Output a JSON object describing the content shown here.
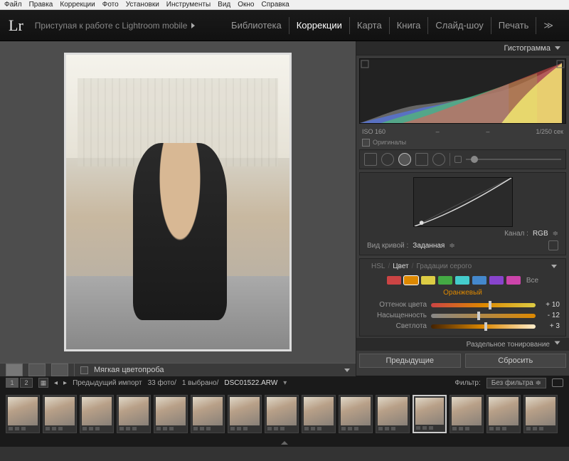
{
  "os_menu": [
    "Файл",
    "Правка",
    "Коррекции",
    "Фото",
    "Установки",
    "Инструменты",
    "Вид",
    "Окно",
    "Справка"
  ],
  "header": {
    "logo": "Lr",
    "mobile_link": "Приступая к работе с Lightroom mobile",
    "modules": [
      {
        "label": "Библиотека",
        "active": false
      },
      {
        "label": "Коррекции",
        "active": true
      },
      {
        "label": "Карта",
        "active": false
      },
      {
        "label": "Книга",
        "active": false
      },
      {
        "label": "Слайд-шоу",
        "active": false
      },
      {
        "label": "Печать",
        "active": false
      }
    ],
    "more_glyph": "≫"
  },
  "left_toolbar": {
    "softproof_label": "Мягкая цветопроба"
  },
  "panels": {
    "histogram": {
      "title": "Гистограмма",
      "meta": {
        "iso": "ISO 160",
        "aperture": "–",
        "focal": "–",
        "shutter": "1/250 сек"
      },
      "originals_label": "Оригиналы"
    },
    "tonecurve": {
      "channel_label": "Канал :",
      "channel_value": "RGB",
      "curve_type_label": "Вид кривой :",
      "curve_type_value": "Заданная"
    },
    "hsl": {
      "tabs": {
        "hsl": "HSL",
        "color": "Цвет",
        "bw": "Градации серого"
      },
      "active_tab": "Цвет",
      "all_label": "Все",
      "colors": [
        "#c44",
        "#d80",
        "#dc4",
        "#4a4",
        "#4cc",
        "#48c",
        "#84c",
        "#c4a"
      ],
      "selected_color_label": "Оранжевый",
      "sliders": [
        {
          "label": "Оттенок цвета",
          "value": "+ 10",
          "pos": 55,
          "gradient": "linear-gradient(90deg,#c44,#d80,#dc4)"
        },
        {
          "label": "Насыщенность",
          "value": "- 12",
          "pos": 44,
          "gradient": "linear-gradient(90deg,#888,#d80)"
        },
        {
          "label": "Светлота",
          "value": "+ 3",
          "pos": 51,
          "gradient": "linear-gradient(90deg,#420,#d80,#fec)"
        }
      ]
    },
    "split_toning": {
      "title": "Раздельное тонирование"
    },
    "bottom": {
      "prev": "Предыдущие",
      "reset": "Сбросить"
    }
  },
  "info_bar": {
    "view1": "1",
    "view2": "2",
    "prev_import": "Предыдущий импорт",
    "count": "33 фото/",
    "selected": "1 выбрано/",
    "filename": "DSC01522.ARW",
    "filter_label": "Фильтр:",
    "filter_value": "Без фильтра"
  },
  "filmstrip": {
    "count": 15,
    "selected_index": 11
  }
}
